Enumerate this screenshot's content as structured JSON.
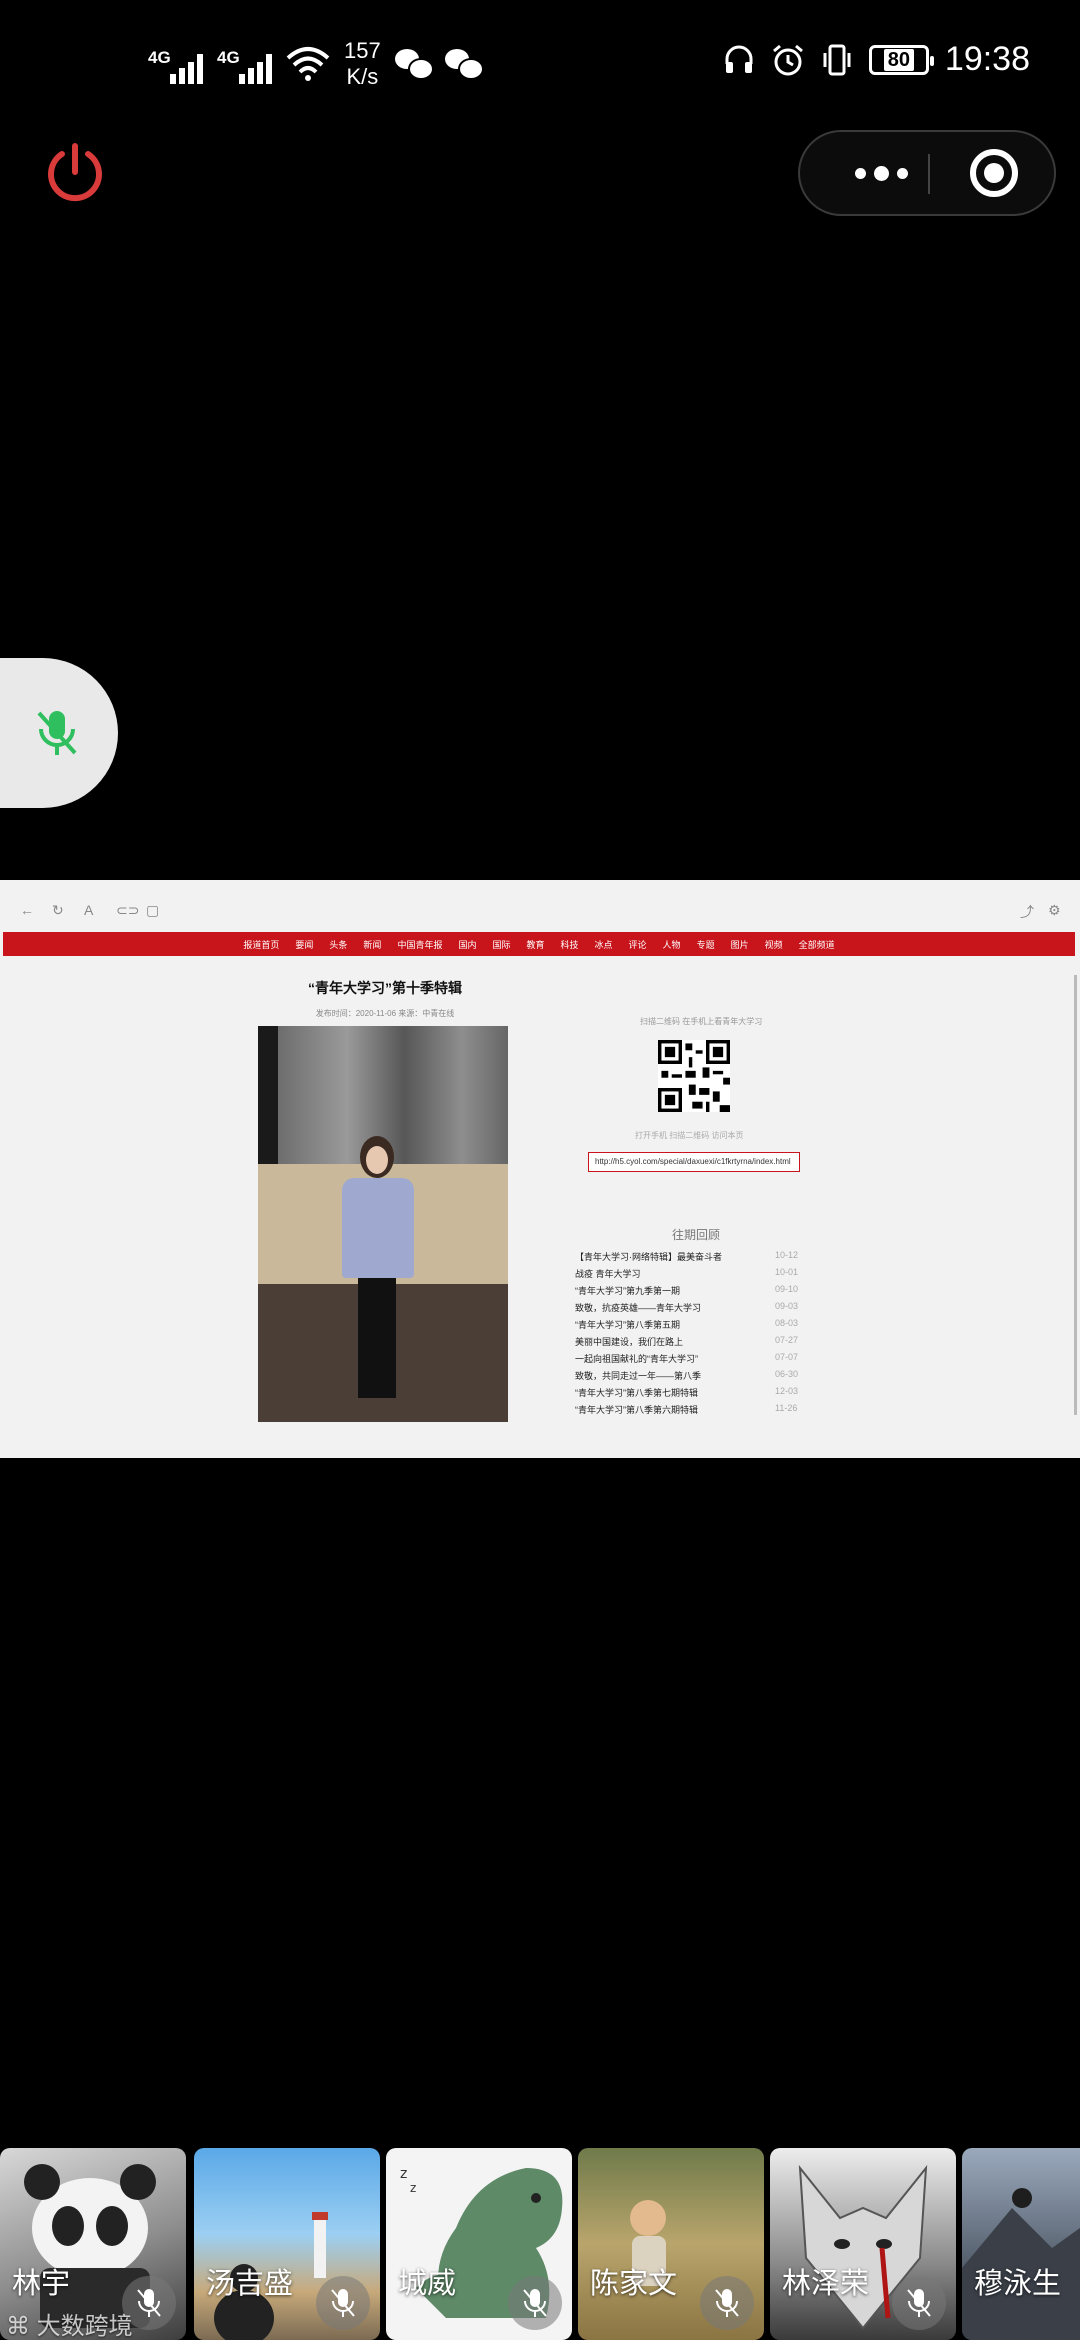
{
  "status_bar": {
    "network_1": "4G",
    "network_2": "4G",
    "speed_value": "157",
    "speed_unit": "K/s",
    "battery": "80",
    "time": "19:38"
  },
  "shared_screen": {
    "nav_items": [
      "报道首页",
      "要闻",
      "头条",
      "新闻",
      "中国青年报",
      "国内",
      "国际",
      "教育",
      "科技",
      "冰点",
      "评论",
      "人物",
      "专题",
      "图片",
      "视频",
      "全部频道"
    ],
    "article_title": "“青年大学习”第十季特辑",
    "article_meta": "发布时间：2020-11-06 来源：中青在线",
    "qr_caption": "扫描二维码 在手机上看青年大学习",
    "qr_caption_2": "打开手机 扫描二维码 访问本页",
    "url": "http://h5.cyol.com/special/daxuexi/c1fkrtyrna/index.html",
    "related_title": "往期回顾",
    "related": [
      {
        "title": "【青年大学习·网络特辑】最美奋斗者",
        "date": "10-12"
      },
      {
        "title": "战疫 青年大学习",
        "date": "10-01"
      },
      {
        "title": "“青年大学习”第九季第一期",
        "date": "09-10"
      },
      {
        "title": "致敬，抗疫英雄——青年大学习",
        "date": "09-03"
      },
      {
        "title": "“青年大学习”第八季第五期",
        "date": "08-03"
      },
      {
        "title": "美丽中国建设，我们在路上",
        "date": "07-27"
      },
      {
        "title": "一起向祖国献礼的“青年大学习”",
        "date": "07-07"
      },
      {
        "title": "致敬，共同走过一年——第八季",
        "date": "06-30"
      },
      {
        "title": "“青年大学习”第八季第七期特辑",
        "date": "12-03"
      },
      {
        "title": "“青年大学习”第八季第六期特辑",
        "date": "11-26"
      }
    ]
  },
  "participants": [
    {
      "name": "林宇"
    },
    {
      "name": "汤吉盛"
    },
    {
      "name": "城威"
    },
    {
      "name": "陈家文"
    },
    {
      "name": "林泽荣"
    },
    {
      "name": "穆泳生"
    }
  ],
  "watermark": "大数跨境",
  "colors": {
    "power_red": "#d93a3a",
    "mic_green": "#2fbf5f",
    "nav_red": "#c8141b"
  }
}
